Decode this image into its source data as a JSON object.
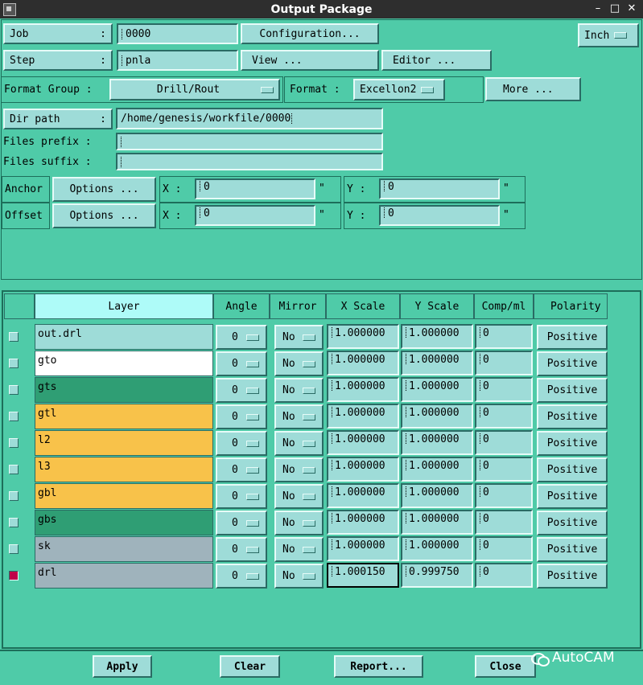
{
  "window": {
    "title": "Output Package",
    "minimize": "–",
    "maximize": "□",
    "close": "✕"
  },
  "top": {
    "job_label": "Job",
    "job_colon": ":",
    "job_value": "0000",
    "configuration_btn": "Configuration...",
    "units": "Inch",
    "step_label": "Step",
    "step_colon": ":",
    "step_value": "pnla",
    "view_btn": "View ...",
    "editor_btn": "Editor ...",
    "format_group_label": "Format Group :",
    "format_group_value": "Drill/Rout",
    "format_label": "Format :",
    "format_value": "Excellon2",
    "more_btn": "More ...",
    "dir_path_label": "Dir path",
    "dir_path_colon": ":",
    "dir_path_value": "/home/genesis/workfile/0000",
    "files_prefix_label": "Files prefix :",
    "files_prefix_value": "",
    "files_suffix_label": "Files suffix :",
    "files_suffix_value": "",
    "anchor_label": "Anchor",
    "anchor_options": "Options ...",
    "anchor_x_label": "X :",
    "anchor_x_value": "0",
    "anchor_x_unit": "\"",
    "anchor_y_label": "Y :",
    "anchor_y_value": "0",
    "anchor_y_unit": "\"",
    "offset_label": "Offset",
    "offset_options": "Options ...",
    "offset_x_label": "X :",
    "offset_x_value": "0",
    "offset_x_unit": "\"",
    "offset_y_label": "Y :",
    "offset_y_value": "0",
    "offset_y_unit": "\""
  },
  "table": {
    "headers": {
      "layer": "Layer",
      "angle": "Angle",
      "mirror": "Mirror",
      "xscale": "X Scale",
      "yscale": "Y Scale",
      "comp": "Comp/ml",
      "polarity": "Polarity"
    },
    "rows": [
      {
        "checked": false,
        "layer": "out.drl",
        "color": "#9edcd8",
        "angle": "0",
        "mirror": "No",
        "xscale": "1.000000",
        "yscale": "1.000000",
        "comp": "0",
        "polarity": "Positive"
      },
      {
        "checked": false,
        "layer": "gto",
        "color": "#ffffff",
        "angle": "0",
        "mirror": "No",
        "xscale": "1.000000",
        "yscale": "1.000000",
        "comp": "0",
        "polarity": "Positive"
      },
      {
        "checked": false,
        "layer": "gts",
        "color": "#2f9e74",
        "angle": "0",
        "mirror": "No",
        "xscale": "1.000000",
        "yscale": "1.000000",
        "comp": "0",
        "polarity": "Positive"
      },
      {
        "checked": false,
        "layer": "gtl",
        "color": "#f8c24a",
        "angle": "0",
        "mirror": "No",
        "xscale": "1.000000",
        "yscale": "1.000000",
        "comp": "0",
        "polarity": "Positive"
      },
      {
        "checked": false,
        "layer": "l2",
        "color": "#f8c24a",
        "angle": "0",
        "mirror": "No",
        "xscale": "1.000000",
        "yscale": "1.000000",
        "comp": "0",
        "polarity": "Positive"
      },
      {
        "checked": false,
        "layer": "l3",
        "color": "#f8c24a",
        "angle": "0",
        "mirror": "No",
        "xscale": "1.000000",
        "yscale": "1.000000",
        "comp": "0",
        "polarity": "Positive"
      },
      {
        "checked": false,
        "layer": "gbl",
        "color": "#f8c24a",
        "angle": "0",
        "mirror": "No",
        "xscale": "1.000000",
        "yscale": "1.000000",
        "comp": "0",
        "polarity": "Positive"
      },
      {
        "checked": false,
        "layer": "gbs",
        "color": "#2f9e74",
        "angle": "0",
        "mirror": "No",
        "xscale": "1.000000",
        "yscale": "1.000000",
        "comp": "0",
        "polarity": "Positive"
      },
      {
        "checked": false,
        "layer": "sk",
        "color": "#9fb3bc",
        "angle": "0",
        "mirror": "No",
        "xscale": "1.000000",
        "yscale": "1.000000",
        "comp": "0",
        "polarity": "Positive"
      },
      {
        "checked": true,
        "layer": "drl",
        "color": "#9fb3bc",
        "angle": "0",
        "mirror": "No",
        "xscale": "1.000150",
        "yscale": "0.999750",
        "comp": "0",
        "polarity": "Positive"
      }
    ]
  },
  "bottom": {
    "apply": "Apply",
    "clear": "Clear",
    "report": "Report...",
    "close": "Close"
  },
  "watermark": "AutoCAM"
}
